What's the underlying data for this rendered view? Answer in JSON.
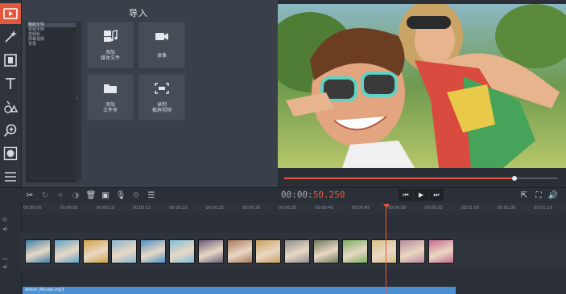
{
  "toolbar": {
    "tools": [
      {
        "name": "import-icon",
        "active": true
      },
      {
        "name": "magic-wand-icon",
        "active": false
      },
      {
        "name": "film-icon",
        "active": false
      },
      {
        "name": "text-icon",
        "active": false
      },
      {
        "name": "shapes-icon",
        "active": false
      },
      {
        "name": "zoom-icon",
        "active": false
      },
      {
        "name": "record-icon",
        "active": false
      },
      {
        "name": "menu-icon",
        "active": false
      }
    ]
  },
  "import": {
    "title": "导入",
    "files": [
      "我的文件",
      "音频示例",
      "音频轨",
      "屏幕视频",
      "背景"
    ],
    "selected_index": 0,
    "tiles": [
      {
        "line1": "添加",
        "line2": "媒体文件"
      },
      {
        "line1": "录像",
        "line2": ""
      },
      {
        "line1": "添加",
        "line2": "文件夹"
      },
      {
        "line1": "录制",
        "line2": "截屏视频"
      }
    ]
  },
  "player": {
    "progress": 0.84
  },
  "timeline": {
    "timecode_main": "00:00:",
    "timecode_sub": "50.250",
    "ruler": [
      "00:00:00",
      "00:00:05",
      "00:00:10",
      "00:00:15",
      "00:00:20",
      "00:00:25",
      "00:00:30",
      "00:00:35",
      "00:00:40",
      "00:00:45",
      "00:00:50",
      "00:00:55",
      "00:01:00",
      "00:01:05",
      "00:01:10"
    ],
    "audio_clip_label": "Action_Movies.mp3",
    "clip_colors": [
      "#3f7fa7",
      "#5fa3c9",
      "#d0a24a",
      "#8bb6d0",
      "#4d90c8",
      "#7fc0de",
      "#6a5b78",
      "#a8785c",
      "#caa060",
      "#8f8f8f",
      "#6f7a5e",
      "#77b061",
      "#d6c089",
      "#b8899a",
      "#c76c8c"
    ],
    "accent": "#e2583e",
    "audio_color": "#4a8fd4"
  }
}
